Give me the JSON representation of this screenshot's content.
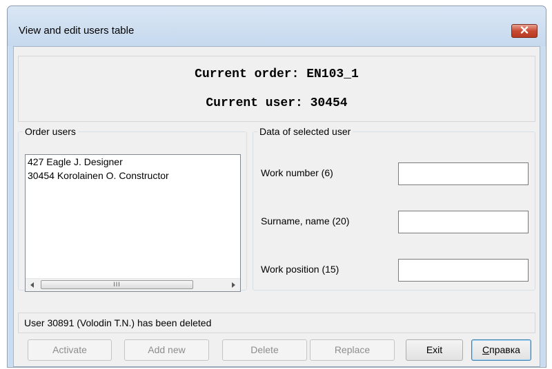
{
  "window": {
    "title": "View and edit users table"
  },
  "header": {
    "current_order": "Current order: EN103_1",
    "current_user": "Current user: 30454"
  },
  "order_users": {
    "title": "Order users",
    "items": [
      "427 Eagle J. Designer",
      "30454 Korolainen O. Constructor"
    ]
  },
  "selected_user": {
    "title": "Data of selected user",
    "work_number_label": "Work number (6)",
    "work_number_value": "",
    "surname_label": "Surname, name (20)",
    "surname_value": "",
    "position_label": "Work position (15)",
    "position_value": ""
  },
  "status": {
    "message": "User 30891 (Volodin T.N.) has been deleted"
  },
  "buttons": {
    "activate": "Activate",
    "add_new": "Add new",
    "delete": "Delete",
    "replace": "Replace",
    "exit": "Exit",
    "help_underlined": "С",
    "help_rest": "правка"
  },
  "icons": {
    "close": "close-icon",
    "scroll_left": "arrow-left-icon",
    "scroll_right": "arrow-right-icon",
    "scroll_grip": "grip-icon"
  },
  "colors": {
    "title_bar": "#c9dcf0",
    "close_button": "#c94a32",
    "client": "#f0f0f0",
    "default_button_border": "#3c7fb1"
  }
}
